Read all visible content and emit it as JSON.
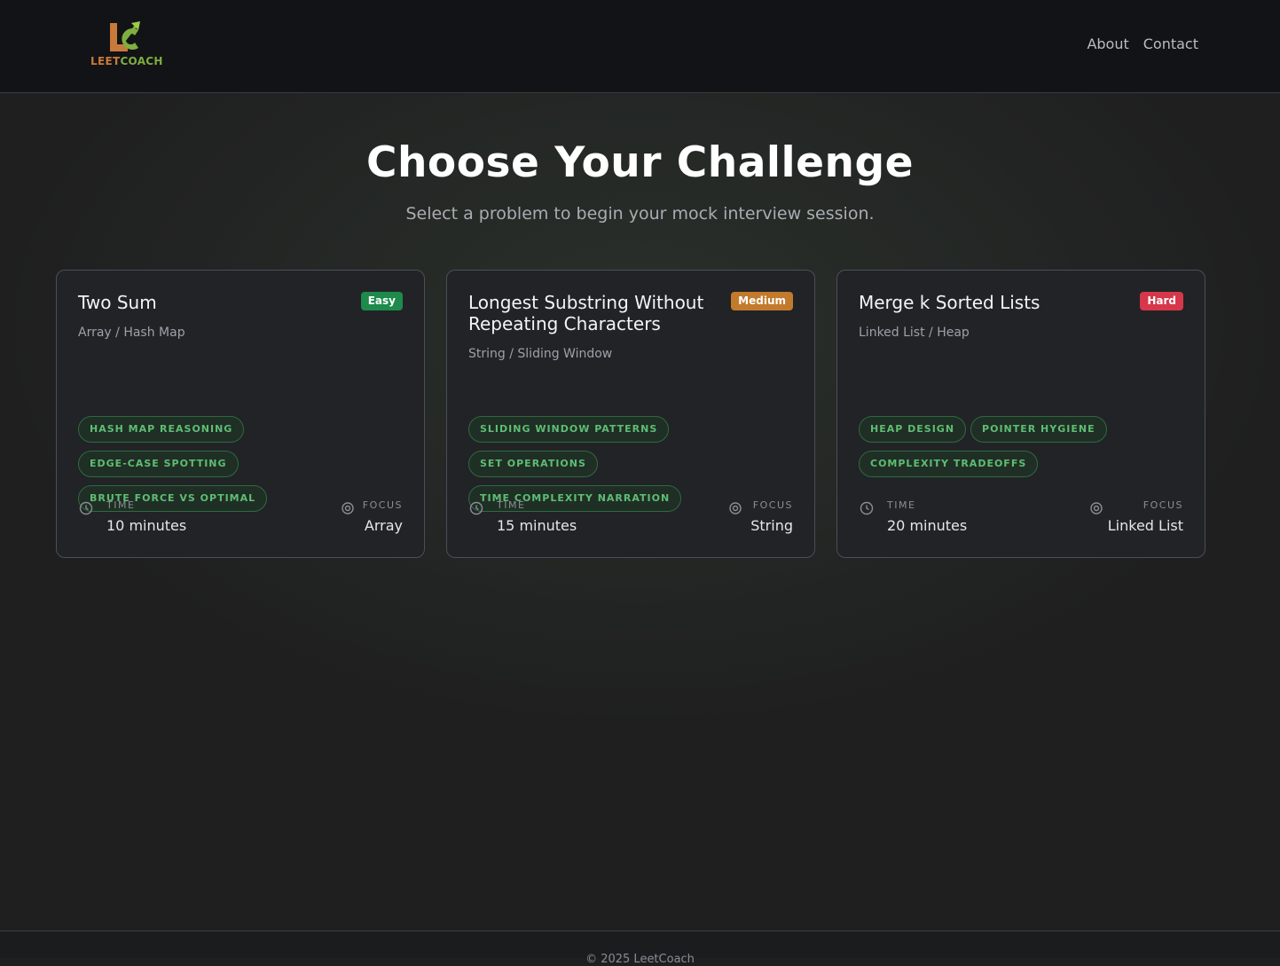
{
  "nav": {
    "logo_leet": "LEET",
    "logo_coach": "COACH",
    "links": [
      "About",
      "Contact"
    ]
  },
  "hero": {
    "title": "Choose Your Challenge",
    "subtitle": "Select a problem to begin your mock interview session."
  },
  "meta_labels": {
    "time": "TIME",
    "focus": "FOCUS"
  },
  "cards": [
    {
      "title": "Two Sum",
      "category": "Array / Hash Map",
      "difficulty": "Easy",
      "difficulty_color": "#1e8a4c",
      "tags": [
        "HASH MAP REASONING",
        "EDGE-CASE SPOTTING",
        "BRUTE FORCE VS OPTIMAL"
      ],
      "time": "10 minutes",
      "focus": "Array"
    },
    {
      "title": "Longest Substring Without Repeating Characters",
      "category": "String / Sliding Window",
      "difficulty": "Medium",
      "difficulty_color": "#c27a2c",
      "tags": [
        "SLIDING WINDOW PATTERNS",
        "SET OPERATIONS",
        "TIME COMPLEXITY NARRATION"
      ],
      "time": "15 minutes",
      "focus": "String"
    },
    {
      "title": "Merge k Sorted Lists",
      "category": "Linked List / Heap",
      "difficulty": "Hard",
      "difficulty_color": "#d6374a",
      "tags": [
        "HEAP DESIGN",
        "POINTER HYGIENE",
        "COMPLEXITY TRADEOFFS"
      ],
      "time": "20 minutes",
      "focus": "Linked List"
    }
  ],
  "footer": {
    "text": "© 2025 LeetCoach"
  },
  "colors": {
    "accent_green": "#5fbd74",
    "background": "#1f1f20",
    "card_background": "#212327"
  },
  "icons": {
    "time": "clock-icon",
    "focus": "target-icon"
  }
}
